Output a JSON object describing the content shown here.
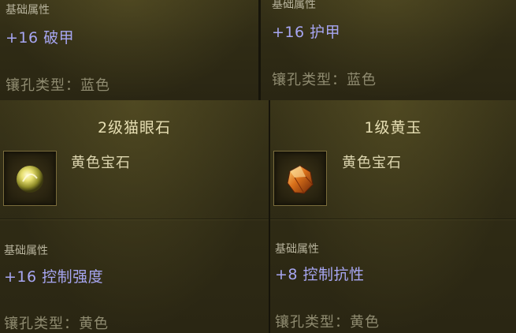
{
  "items": [
    {
      "base_label": "基础属性",
      "stat": "+16 破甲",
      "socket": "镶孔类型：蓝色"
    },
    {
      "base_label": "基础属性",
      "stat": "+16 护甲",
      "socket": "镶孔类型：蓝色"
    },
    {
      "title": "2级猫眼石",
      "gem_type": "黄色宝石",
      "icon": "cats-eye-gem-icon",
      "base_label": "基础属性",
      "stat": "+16 控制强度",
      "socket": "镶孔类型：黄色"
    },
    {
      "title": "1级黄玉",
      "gem_type": "黄色宝石",
      "icon": "topaz-gem-icon",
      "base_label": "基础属性",
      "stat": "+8 控制抗性",
      "socket": "镶孔类型：黄色"
    }
  ],
  "colors": {
    "stat": "#a7a6f2",
    "title": "#e7dfb4",
    "muted": "#8f8b70"
  }
}
